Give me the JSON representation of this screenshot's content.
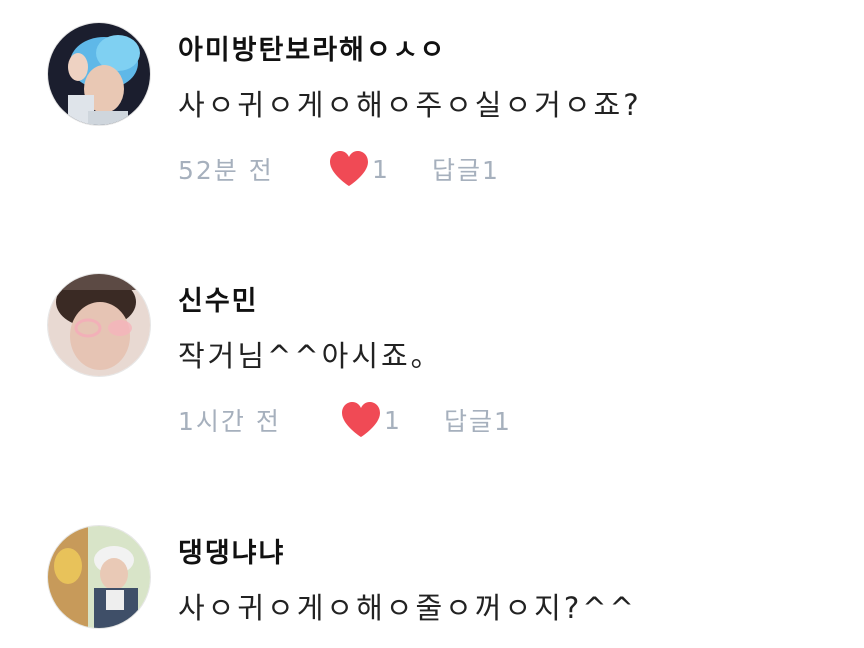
{
  "colors": {
    "heart": "#f04a55",
    "meta_text": "#a6b0bd",
    "author_text": "#111111",
    "body_text": "#222222"
  },
  "comments": [
    {
      "author": "아미방탄보라해ㅇㅅㅇ",
      "text": "사ㅇ귀ㅇ게ㅇ해ㅇ주ㅇ실ㅇ거ㅇ죠?",
      "time": "52분 전",
      "like_icon": "heart-icon",
      "likes": "1",
      "reply_label": "답글",
      "reply_count": "1"
    },
    {
      "author": "신수민",
      "text": "작거님^^아시죠。",
      "time": "1시간 전",
      "like_icon": "heart-icon",
      "likes": "1",
      "reply_label": "답글",
      "reply_count": "1"
    },
    {
      "author": "댕댕냐냐",
      "text": "사ㅇ귀ㅇ게ㅇ해ㅇ줄ㅇ꺼ㅇ지?^^"
    }
  ]
}
